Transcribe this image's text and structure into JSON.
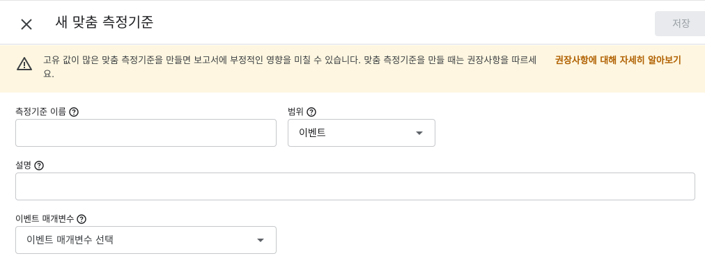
{
  "header": {
    "title": "새 맞춤 측정기준",
    "save_label": "저장"
  },
  "banner": {
    "message": "고유 값이 많은 맞춤 측정기준을 만들면 보고서에 부정적인 영향을 미칠 수 있습니다. 맞춤 측정기준을 만들 때는 권장사항을 따르세요.",
    "link_label": "권장사항에 대해 자세히 알아보기"
  },
  "form": {
    "dimension_name": {
      "label": "측정기준 이름",
      "value": "",
      "placeholder": ""
    },
    "scope": {
      "label": "범위",
      "selected": "이벤트"
    },
    "description": {
      "label": "설명",
      "value": "",
      "placeholder": ""
    },
    "event_parameter": {
      "label": "이벤트 매개변수",
      "selected": "이벤트 매개변수 선택"
    }
  },
  "colors": {
    "banner_bg": "#fef6e0",
    "link": "#b06000",
    "warning_icon": "#3c4043"
  },
  "icons": [
    "close-icon",
    "warning-icon",
    "help-icon",
    "dropdown-arrow-icon"
  ]
}
